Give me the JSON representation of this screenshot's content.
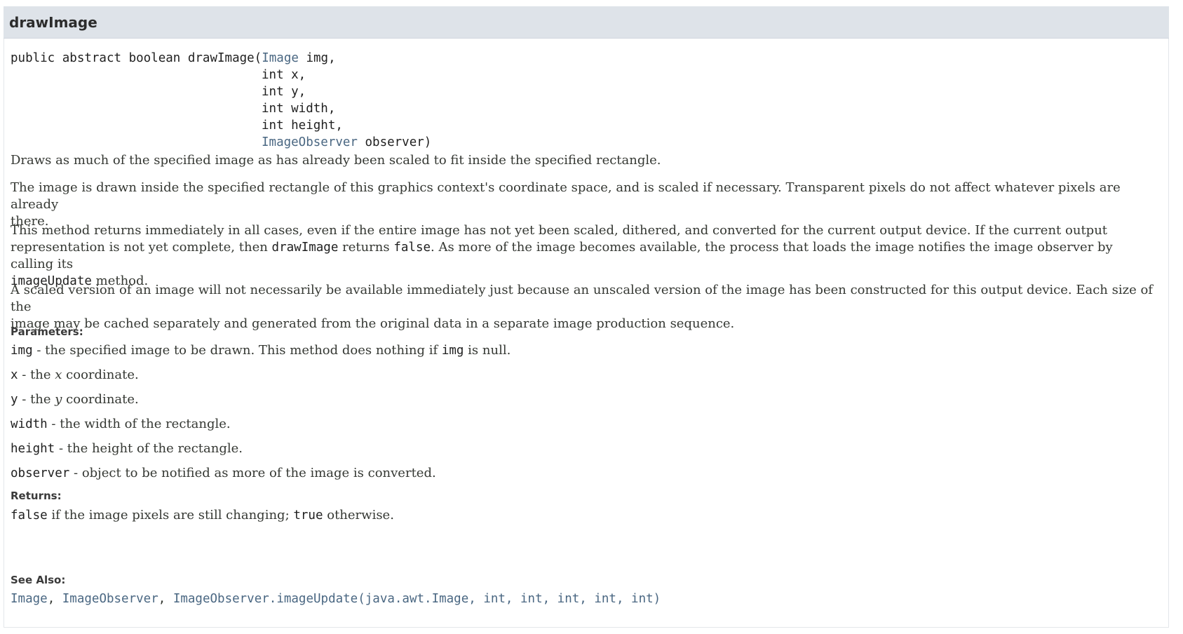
{
  "member": {
    "title": "drawImage"
  },
  "signature": {
    "modifiers": "public abstract boolean drawImage(",
    "params": [
      {
        "type": "Image",
        "type_is_link": true,
        "name": " img,"
      },
      {
        "type": "int",
        "type_is_link": false,
        "name": " x,"
      },
      {
        "type": "int",
        "type_is_link": false,
        "name": " y,"
      },
      {
        "type": "int",
        "type_is_link": false,
        "name": " width,"
      },
      {
        "type": "int",
        "type_is_link": false,
        "name": " height,"
      },
      {
        "type": "ImageObserver",
        "type_is_link": true,
        "name": " observer)"
      }
    ]
  },
  "description": {
    "p1": "Draws as much of the specified image as has already been scaled to fit inside the specified rectangle.",
    "p2_line1": "The image is drawn inside the specified rectangle of this graphics context's coordinate space, and is scaled if necessary. Transparent pixels do not affect whatever pixels are already",
    "p2_line2": "there.",
    "p3_line1": "This method returns immediately in all cases, even if the entire image has not yet been scaled, dithered, and converted for the current output device. If the current output",
    "p3_line2_a": "representation is not yet complete, then ",
    "p3_line2_code1": "drawImage",
    "p3_line2_b": " returns ",
    "p3_line2_code2": "false",
    "p3_line2_c": ". As more of the image becomes available, the process that loads the image notifies the image observer by calling its",
    "p3_line3_code": "imageUpdate",
    "p3_line3_b": " method.",
    "p4_line1": "A scaled version of an image will not necessarily be available immediately just because an unscaled version of the image has been constructed for this output device. Each size of the",
    "p4_line2": "image may be cached separately and generated from the original data in a separate image production sequence."
  },
  "parameters": {
    "label": "Parameters:",
    "items": [
      {
        "name": "img",
        "desc_a": " - the specified image to be drawn. This method does nothing if ",
        "desc_code": "img",
        "desc_b": " is null."
      },
      {
        "name": "x",
        "desc_a": " - the ",
        "desc_em": "x",
        "desc_b": " coordinate."
      },
      {
        "name": "y",
        "desc_a": " - the ",
        "desc_em": "y",
        "desc_b": " coordinate."
      },
      {
        "name": "width",
        "desc": " - the width of the rectangle."
      },
      {
        "name": "height",
        "desc": " - the height of the rectangle."
      },
      {
        "name": "observer",
        "desc": " - object to be notified as more of the image is converted."
      }
    ]
  },
  "returns": {
    "label": "Returns:",
    "code1": "false",
    "text_a": " if the image pixels are still changing; ",
    "code2": "true",
    "text_b": " otherwise."
  },
  "see_also": {
    "label": "See Also:",
    "links": [
      "Image",
      "ImageObserver",
      "ImageObserver.imageUpdate(java.awt.Image, int, int, int, int, int)"
    ],
    "separator": ", "
  }
}
